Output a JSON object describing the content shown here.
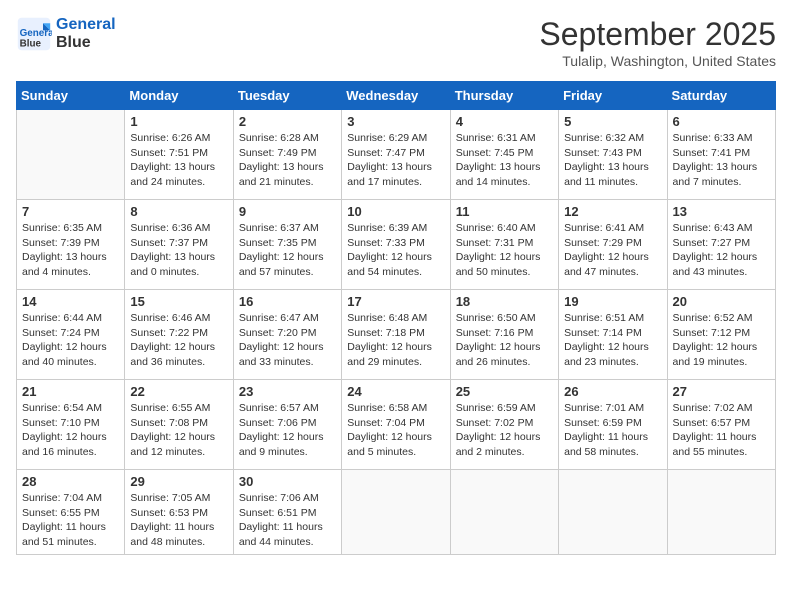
{
  "logo": {
    "line1": "General",
    "line2": "Blue"
  },
  "title": "September 2025",
  "location": "Tulalip, Washington, United States",
  "days_of_week": [
    "Sunday",
    "Monday",
    "Tuesday",
    "Wednesday",
    "Thursday",
    "Friday",
    "Saturday"
  ],
  "weeks": [
    [
      {
        "day": "",
        "info": ""
      },
      {
        "day": "1",
        "info": "Sunrise: 6:26 AM\nSunset: 7:51 PM\nDaylight: 13 hours\nand 24 minutes."
      },
      {
        "day": "2",
        "info": "Sunrise: 6:28 AM\nSunset: 7:49 PM\nDaylight: 13 hours\nand 21 minutes."
      },
      {
        "day": "3",
        "info": "Sunrise: 6:29 AM\nSunset: 7:47 PM\nDaylight: 13 hours\nand 17 minutes."
      },
      {
        "day": "4",
        "info": "Sunrise: 6:31 AM\nSunset: 7:45 PM\nDaylight: 13 hours\nand 14 minutes."
      },
      {
        "day": "5",
        "info": "Sunrise: 6:32 AM\nSunset: 7:43 PM\nDaylight: 13 hours\nand 11 minutes."
      },
      {
        "day": "6",
        "info": "Sunrise: 6:33 AM\nSunset: 7:41 PM\nDaylight: 13 hours\nand 7 minutes."
      }
    ],
    [
      {
        "day": "7",
        "info": "Sunrise: 6:35 AM\nSunset: 7:39 PM\nDaylight: 13 hours\nand 4 minutes."
      },
      {
        "day": "8",
        "info": "Sunrise: 6:36 AM\nSunset: 7:37 PM\nDaylight: 13 hours\nand 0 minutes."
      },
      {
        "day": "9",
        "info": "Sunrise: 6:37 AM\nSunset: 7:35 PM\nDaylight: 12 hours\nand 57 minutes."
      },
      {
        "day": "10",
        "info": "Sunrise: 6:39 AM\nSunset: 7:33 PM\nDaylight: 12 hours\nand 54 minutes."
      },
      {
        "day": "11",
        "info": "Sunrise: 6:40 AM\nSunset: 7:31 PM\nDaylight: 12 hours\nand 50 minutes."
      },
      {
        "day": "12",
        "info": "Sunrise: 6:41 AM\nSunset: 7:29 PM\nDaylight: 12 hours\nand 47 minutes."
      },
      {
        "day": "13",
        "info": "Sunrise: 6:43 AM\nSunset: 7:27 PM\nDaylight: 12 hours\nand 43 minutes."
      }
    ],
    [
      {
        "day": "14",
        "info": "Sunrise: 6:44 AM\nSunset: 7:24 PM\nDaylight: 12 hours\nand 40 minutes."
      },
      {
        "day": "15",
        "info": "Sunrise: 6:46 AM\nSunset: 7:22 PM\nDaylight: 12 hours\nand 36 minutes."
      },
      {
        "day": "16",
        "info": "Sunrise: 6:47 AM\nSunset: 7:20 PM\nDaylight: 12 hours\nand 33 minutes."
      },
      {
        "day": "17",
        "info": "Sunrise: 6:48 AM\nSunset: 7:18 PM\nDaylight: 12 hours\nand 29 minutes."
      },
      {
        "day": "18",
        "info": "Sunrise: 6:50 AM\nSunset: 7:16 PM\nDaylight: 12 hours\nand 26 minutes."
      },
      {
        "day": "19",
        "info": "Sunrise: 6:51 AM\nSunset: 7:14 PM\nDaylight: 12 hours\nand 23 minutes."
      },
      {
        "day": "20",
        "info": "Sunrise: 6:52 AM\nSunset: 7:12 PM\nDaylight: 12 hours\nand 19 minutes."
      }
    ],
    [
      {
        "day": "21",
        "info": "Sunrise: 6:54 AM\nSunset: 7:10 PM\nDaylight: 12 hours\nand 16 minutes."
      },
      {
        "day": "22",
        "info": "Sunrise: 6:55 AM\nSunset: 7:08 PM\nDaylight: 12 hours\nand 12 minutes."
      },
      {
        "day": "23",
        "info": "Sunrise: 6:57 AM\nSunset: 7:06 PM\nDaylight: 12 hours\nand 9 minutes."
      },
      {
        "day": "24",
        "info": "Sunrise: 6:58 AM\nSunset: 7:04 PM\nDaylight: 12 hours\nand 5 minutes."
      },
      {
        "day": "25",
        "info": "Sunrise: 6:59 AM\nSunset: 7:02 PM\nDaylight: 12 hours\nand 2 minutes."
      },
      {
        "day": "26",
        "info": "Sunrise: 7:01 AM\nSunset: 6:59 PM\nDaylight: 11 hours\nand 58 minutes."
      },
      {
        "day": "27",
        "info": "Sunrise: 7:02 AM\nSunset: 6:57 PM\nDaylight: 11 hours\nand 55 minutes."
      }
    ],
    [
      {
        "day": "28",
        "info": "Sunrise: 7:04 AM\nSunset: 6:55 PM\nDaylight: 11 hours\nand 51 minutes."
      },
      {
        "day": "29",
        "info": "Sunrise: 7:05 AM\nSunset: 6:53 PM\nDaylight: 11 hours\nand 48 minutes."
      },
      {
        "day": "30",
        "info": "Sunrise: 7:06 AM\nSunset: 6:51 PM\nDaylight: 11 hours\nand 44 minutes."
      },
      {
        "day": "",
        "info": ""
      },
      {
        "day": "",
        "info": ""
      },
      {
        "day": "",
        "info": ""
      },
      {
        "day": "",
        "info": ""
      }
    ]
  ]
}
